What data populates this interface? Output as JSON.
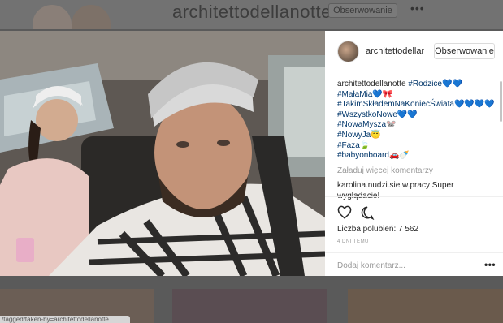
{
  "background": {
    "username": "architettodellanotte",
    "follow_label": "Obserwowanie",
    "more_label": "•••",
    "status_url": "/tagged/taken-by=architettodellanotte"
  },
  "post": {
    "header": {
      "username": "architettodellanc",
      "follow_label": "Obserwowanie"
    },
    "caption": {
      "username": "architettodellanotte",
      "hashtags": [
        "#Rodzice💙💙",
        "#MałaMia💙🎀",
        "#TakimSkłademNaKoniecŚwiata💙💙💙💙",
        "#WszystkoNowe💙💙",
        "#NowaMysza🐭",
        "#NowyJa😇",
        "#Faza🍃",
        "#babyonboard🚗🍼"
      ]
    },
    "load_more": "Załaduj więcej komentarzy",
    "comment": {
      "username": "karolina.nudzi.sie.w.pracy",
      "text": "Super wyglądacie!"
    },
    "likes": "Liczba polubień: 7 562",
    "time": "4 DNI TEMU",
    "add_comment_placeholder": "Dodaj komentarz...",
    "more_label": "•••"
  },
  "colors": {
    "hashtag": "#003569",
    "secondary_text": "#999999",
    "primary_text": "#262626"
  }
}
